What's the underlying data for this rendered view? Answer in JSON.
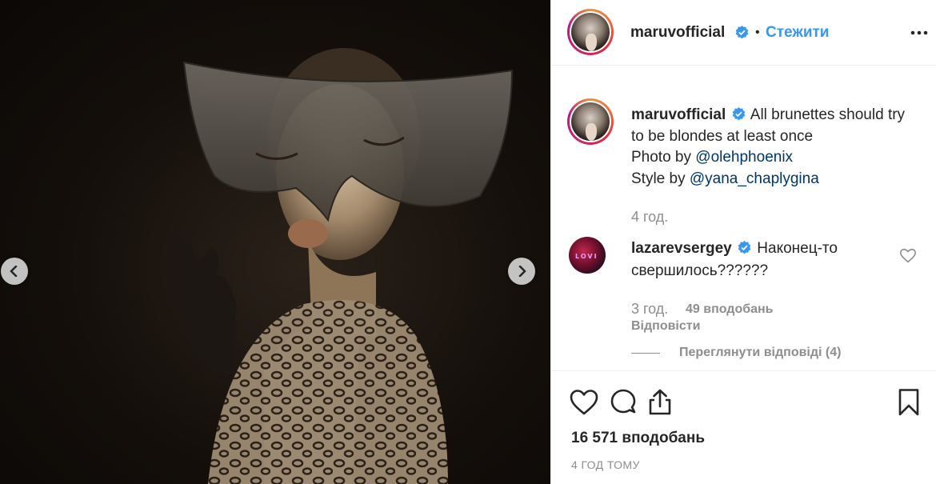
{
  "post": {
    "username": "maruvofficial",
    "follow_label": "Стежити",
    "separator": "•",
    "caption_text": "All brunettes should try to be blondes at least once",
    "photo_by_prefix": "Photo by ",
    "photo_by_handle": "@olehphoenix",
    "style_by_prefix": "Style by ",
    "style_by_handle": "@yana_chaplygina",
    "caption_time": "4 год.",
    "likes_count": "16 571 вподобань",
    "posted_ago": "4 ГОД ТОМУ"
  },
  "comment": {
    "username": "lazarevsergey",
    "avatar_text": "LOVI",
    "text": "Наконец-то свершилось??????",
    "time": "3 год.",
    "likes": "49 вподобань",
    "reply_label": "Відповісти",
    "view_replies_label": "Переглянути відповіді (4)"
  },
  "icons": {
    "prev": "chevron-left-icon",
    "next": "chevron-right-icon",
    "verified": "verified-badge-icon",
    "more": "more-options-icon",
    "like": "heart-icon",
    "comment": "comment-icon",
    "share": "share-icon",
    "save": "bookmark-icon"
  },
  "colors": {
    "link_blue": "#3897f0",
    "mention": "#003569",
    "muted": "#8e8e8e",
    "text": "#262626",
    "verified": "#3897f0"
  }
}
